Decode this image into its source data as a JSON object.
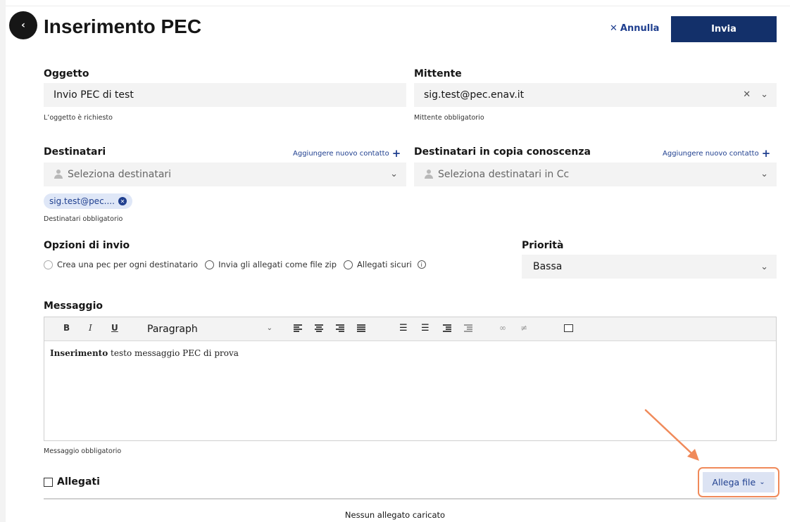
{
  "header": {
    "title": "Inserimento PEC",
    "cancel_label": "Annulla",
    "send_label": "Invia"
  },
  "oggetto": {
    "label": "Oggetto",
    "value": "Invio PEC di test",
    "help": "L’oggetto è richiesto"
  },
  "mittente": {
    "label": "Mittente",
    "value": "sig.test@pec.enav.it",
    "help": "Mittente obbligatorio"
  },
  "destinatari": {
    "label": "Destinatari",
    "add_label": "Aggiungere nuovo contatto",
    "placeholder": "Seleziona destinatari",
    "chip": "sig.test@pec....",
    "help": "Destinatari obbligatorio"
  },
  "destinatari_cc": {
    "label": "Destinatari in copia conoscenza",
    "add_label": "Aggiungere nuovo contatto",
    "placeholder": "Seleziona destinatari in Cc"
  },
  "opzioni": {
    "label": "Opzioni di invio",
    "items": [
      "Crea una pec per ogni destinatario",
      "Invia gli allegati come file zip",
      "Allegati sicuri"
    ]
  },
  "priorita": {
    "label": "Priorità",
    "value": "Bassa"
  },
  "messaggio": {
    "label": "Messaggio",
    "format": "Paragraph",
    "content_bold": "Inserimento",
    "content_rest": " testo messaggio PEC di prova",
    "help": "Messaggio obbligatorio"
  },
  "allegati": {
    "label": "Allegati",
    "attach_label": "Allega file",
    "empty": "Nessun allegato caricato"
  },
  "colors": {
    "primary": "#13306a",
    "link": "#1f3f8f",
    "highlight": "#f08a5a"
  }
}
